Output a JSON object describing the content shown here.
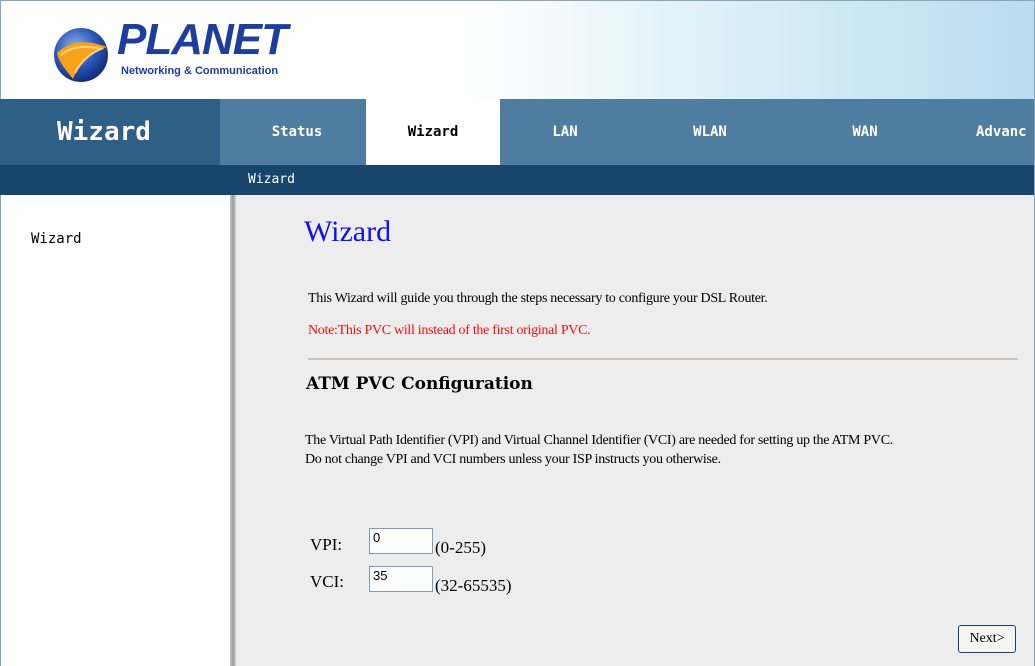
{
  "header": {
    "logo_text": "PLANET",
    "logo_subtitle": "Networking & Communication",
    "colors": {
      "logo_blue": "#1f3d9c",
      "globe_orange": "#f7a21b"
    }
  },
  "nav": {
    "section_title": "Wizard",
    "tabs": [
      {
        "label": "Status"
      },
      {
        "label": "Wizard",
        "active": true
      },
      {
        "label": "LAN"
      },
      {
        "label": "WLAN"
      },
      {
        "label": "WAN"
      },
      {
        "label": "Advanc"
      }
    ],
    "colors": {
      "bar": "#4f7da0",
      "title_bg": "#2e5f86",
      "subnav": "#17456c"
    }
  },
  "subnav": {
    "items": [
      "Wizard"
    ]
  },
  "sidebar": {
    "items": [
      "Wizard"
    ]
  },
  "main": {
    "title": "Wizard",
    "intro": "This Wizard will guide you through the steps necessary to configure your DSL Router.",
    "note": "Note:This PVC will instead of the first original PVC.",
    "section_heading": "ATM PVC Configuration",
    "description_line1": "The Virtual Path Identifier (VPI) and Virtual Channel Identifier (VCI) are needed for setting up the ATM PVC.",
    "description_line2": "Do not change VPI and VCI numbers unless your ISP instructs you otherwise.",
    "fields": {
      "vpi": {
        "label": "VPI:",
        "value": "0",
        "range": "(0-255)"
      },
      "vci": {
        "label": "VCI:",
        "value": "35",
        "range": "(32-65535)"
      }
    },
    "next_button": "Next>",
    "colors": {
      "title": "#1010ee",
      "note": "#ee1111",
      "background": "#ededed"
    }
  }
}
